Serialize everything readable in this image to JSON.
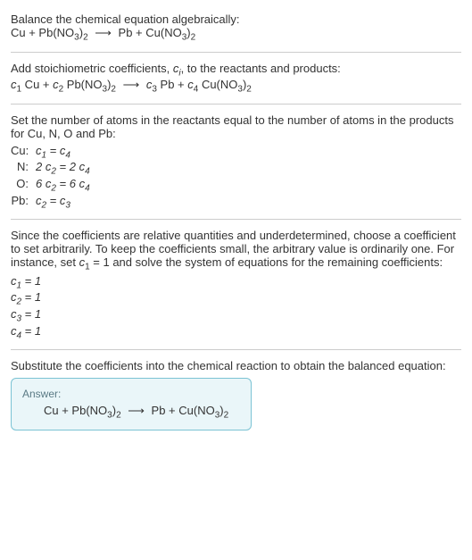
{
  "step1": {
    "instruction": "Balance the chemical equation algebraically:",
    "equation_left": "Cu + Pb(NO",
    "equation_left2": ")",
    "equation_right": "Pb + Cu(NO",
    "equation_right2": ")"
  },
  "step2": {
    "instruction_a": "Add stoichiometric coefficients, ",
    "instruction_b": ", to the reactants and products:",
    "c1": "c",
    "c2": "c",
    "c3": "c",
    "c4": "c",
    "cu": " Cu + ",
    "pb_no": " Pb(NO",
    "close_paren": ")",
    "pb": " Pb + ",
    "cu_no": " Cu(NO"
  },
  "step3": {
    "instruction": "Set the number of atoms in the reactants equal to the number of atoms in the products for Cu, N, O and Pb:",
    "rows": [
      {
        "label": "Cu:",
        "lhs_coef": "",
        "lhs_c": "c",
        "lhs_sub": "1",
        "eq": " = ",
        "rhs_coef": "",
        "rhs_c": "c",
        "rhs_sub": "4"
      },
      {
        "label": "N:",
        "lhs_coef": "2 ",
        "lhs_c": "c",
        "lhs_sub": "2",
        "eq": " = 2 ",
        "rhs_coef": "",
        "rhs_c": "c",
        "rhs_sub": "4"
      },
      {
        "label": "O:",
        "lhs_coef": "6 ",
        "lhs_c": "c",
        "lhs_sub": "2",
        "eq": " = 6 ",
        "rhs_coef": "",
        "rhs_c": "c",
        "rhs_sub": "4"
      },
      {
        "label": "Pb:",
        "lhs_coef": "",
        "lhs_c": "c",
        "lhs_sub": "2",
        "eq": " = ",
        "rhs_coef": "",
        "rhs_c": "c",
        "rhs_sub": "3"
      }
    ]
  },
  "step4": {
    "instruction_a": "Since the coefficients are relative quantities and underdetermined, choose a coefficient to set arbitrarily. To keep the coefficients small, the arbitrary value is ordinarily one. For instance, set ",
    "instruction_b": " = 1 and solve the system of equations for the remaining coefficients:",
    "c": "c",
    "results": [
      {
        "c": "c",
        "sub": "1",
        "val": " = 1"
      },
      {
        "c": "c",
        "sub": "2",
        "val": " = 1"
      },
      {
        "c": "c",
        "sub": "3",
        "val": " = 1"
      },
      {
        "c": "c",
        "sub": "4",
        "val": " = 1"
      }
    ]
  },
  "step5": {
    "instruction": "Substitute the coefficients into the chemical reaction to obtain the balanced equation:"
  },
  "answer": {
    "label": "Answer:",
    "left1": "Cu + Pb(NO",
    "left2": ")",
    "right1": "Pb + Cu(NO",
    "right2": ")"
  },
  "subs": {
    "three": "3",
    "two": "2",
    "one": "1",
    "four": "4",
    "i": "i"
  },
  "arrow": "⟶"
}
